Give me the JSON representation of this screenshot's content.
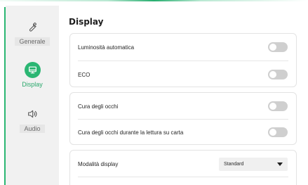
{
  "colors": {
    "accent": "#2bb673",
    "sidebar_bg": "#f1f1f1",
    "toggle_off": "#cfcfcf"
  },
  "sidebar": {
    "items": [
      {
        "label": "Generale",
        "icon": "wrench-icon",
        "active": false
      },
      {
        "label": "Display",
        "icon": "monitor-icon",
        "active": true
      },
      {
        "label": "Audio",
        "icon": "speaker-icon",
        "active": false
      }
    ]
  },
  "main": {
    "title": "Display",
    "groups": [
      {
        "rows": [
          {
            "label": "Luminosità automatica",
            "control": "toggle",
            "on": false
          },
          {
            "label": "ECO",
            "control": "toggle",
            "on": false
          }
        ]
      },
      {
        "rows": [
          {
            "label": "Cura degli occhi",
            "control": "toggle",
            "on": false
          },
          {
            "label": "Cura degli occhi durante la lettura su carta",
            "control": "toggle",
            "on": false
          }
        ]
      },
      {
        "rows": [
          {
            "label": "Modalità display",
            "control": "select",
            "value": "Standard"
          }
        ]
      }
    ]
  }
}
